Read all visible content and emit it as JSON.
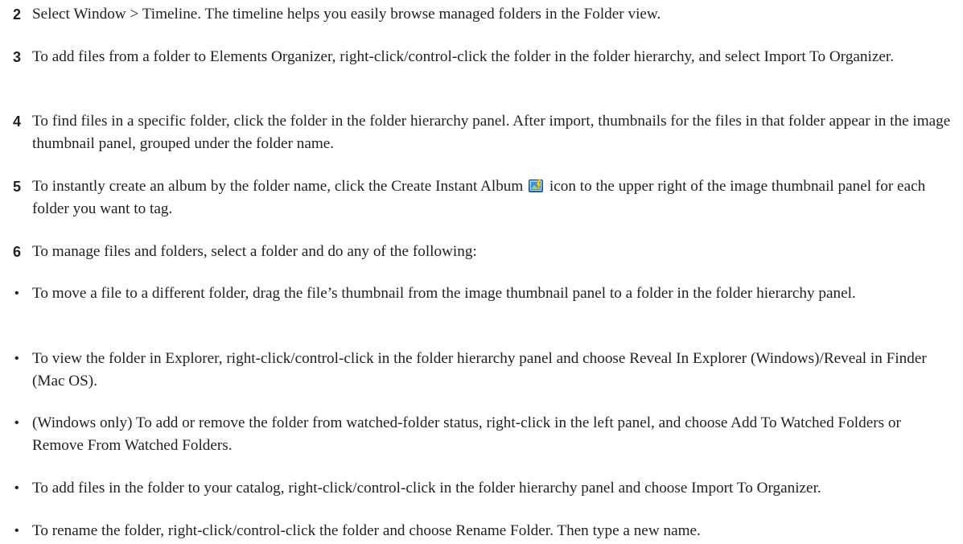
{
  "steps": [
    {
      "number": "2",
      "text": "Select Window > Timeline. The timeline helps you easily browse managed folders in the Folder view."
    },
    {
      "number": "3",
      "text": "To add files from a folder to Elements Organizer, right-click/control-click the folder in the folder hierarchy, and select Import To Organizer."
    },
    {
      "number": "4",
      "text": "To find files in a specific folder, click the folder in the folder hierarchy panel. After import, thumbnails for the files in that folder appear in the image thumbnail panel, grouped under the folder name."
    },
    {
      "number": "5",
      "text_before": "To instantly create an album by the folder name, click the Create Instant Album",
      "icon": "create-instant-album-icon",
      "text_after": "icon to the upper right of the image thumbnail panel for each folder you want to tag."
    },
    {
      "number": "6",
      "text": "To manage files and folders, select a folder and do any of the following:"
    }
  ],
  "bullets": [
    {
      "marker": "•",
      "text": "To move a file to a different folder, drag the file’s thumbnail from the image thumbnail panel to a folder in the folder hierarchy panel."
    },
    {
      "marker": "•",
      "text": "To view the folder in Explorer, right-click/control-click in the folder hierarchy panel and choose Reveal In Explorer (Windows)/Reveal in Finder (Mac OS)."
    },
    {
      "marker": "•",
      "text": "(Windows only) To add or remove the folder from watched-folder status, right-click in the left panel, and choose Add To Watched Folders or Remove From Watched Folders."
    },
    {
      "marker": "•",
      "text": "To add files in the folder to your catalog, right-click/control-click in the folder hierarchy panel and choose Import To Organizer."
    },
    {
      "marker": "•",
      "text": "To rename the folder, right-click/control-click the folder and choose Rename Folder. Then type a new name."
    }
  ]
}
